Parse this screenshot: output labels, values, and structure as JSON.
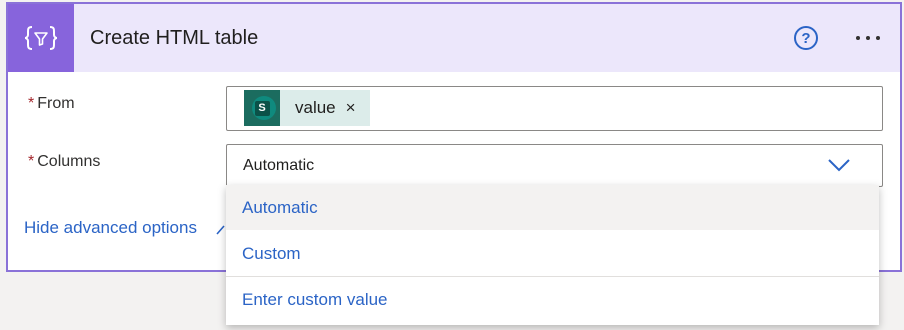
{
  "action": {
    "title": "Create HTML table",
    "icon": "data-operation-icon"
  },
  "header": {
    "help_label": "?",
    "more_icon": "more-icon"
  },
  "fields": {
    "from": {
      "required_mark": "*",
      "label": "From",
      "token": {
        "label": "value",
        "icon": "sharepoint-icon",
        "icon_letter": "S",
        "remove_label": "×"
      }
    },
    "columns": {
      "required_mark": "*",
      "label": "Columns",
      "value": "Automatic"
    }
  },
  "advanced": {
    "label": "Hide advanced options"
  },
  "dropdown": {
    "options": [
      {
        "label": "Automatic",
        "selected": true
      },
      {
        "label": "Custom",
        "selected": false
      },
      {
        "label": "Enter custom value",
        "selected": false
      }
    ]
  },
  "colors": {
    "accent": "#8764dc",
    "header_bg": "#ece7fb",
    "link": "#2b64c6",
    "required": "#a4262c"
  }
}
